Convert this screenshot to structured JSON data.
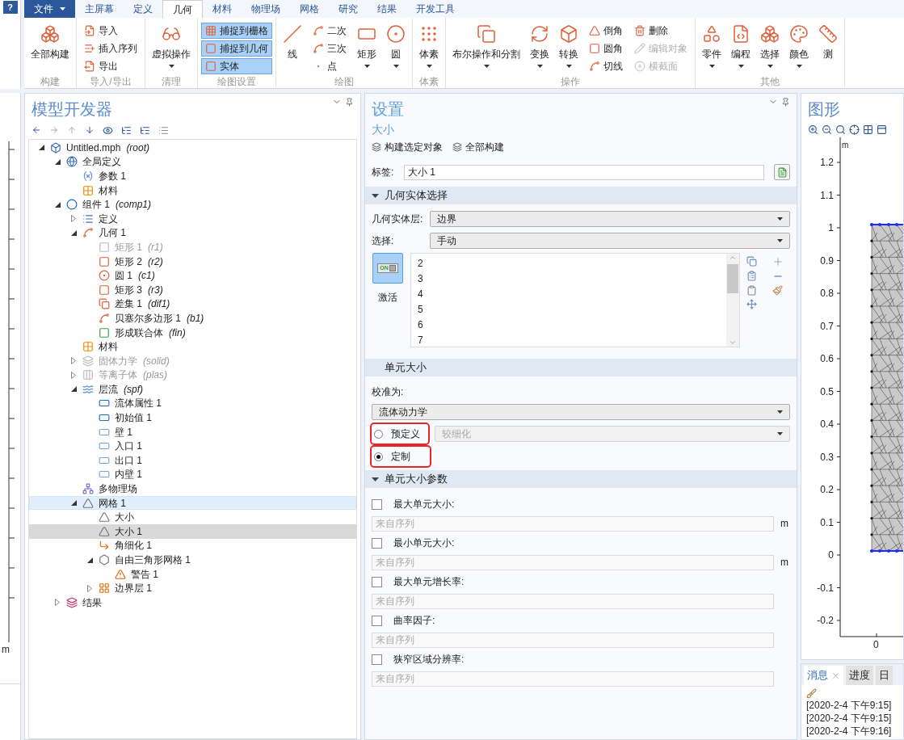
{
  "left_strip": {
    "help": "?",
    "axis_unit": "m"
  },
  "file_menu": {
    "label": "文件"
  },
  "tabs": [
    {
      "label": "主屏幕",
      "selected": false
    },
    {
      "label": "定义",
      "selected": false
    },
    {
      "label": "几何",
      "selected": true
    },
    {
      "label": "材料",
      "selected": false
    },
    {
      "label": "物理场",
      "selected": false
    },
    {
      "label": "网格",
      "selected": false
    },
    {
      "label": "研究",
      "selected": false
    },
    {
      "label": "结果",
      "selected": false
    },
    {
      "label": "开发工具",
      "selected": false
    }
  ],
  "ribbon": [
    {
      "label": "构建",
      "items": [
        {
          "kind": "large",
          "label": "全部构建",
          "dropdown": false
        }
      ]
    },
    {
      "label": "导入/导出",
      "items": [
        {
          "kind": "stack",
          "items": [
            {
              "label": "导入",
              "disabled": false
            },
            {
              "label": "插入序列",
              "disabled": false
            },
            {
              "label": "导出",
              "disabled": false
            }
          ]
        }
      ]
    },
    {
      "label": "清理",
      "items": [
        {
          "kind": "large",
          "label": "虚拟操作",
          "dropdown": true
        }
      ]
    },
    {
      "label": "绘图设置",
      "items": [
        {
          "kind": "toggles",
          "items": [
            {
              "label": "捕捉到栅格",
              "on": true
            },
            {
              "label": "捕捉到几何",
              "on": true
            },
            {
              "label": "实体",
              "on": true
            }
          ]
        }
      ]
    },
    {
      "label": "绘图",
      "items": [
        {
          "kind": "large",
          "label": "线",
          "dropdown": false
        },
        {
          "kind": "stack",
          "items": [
            {
              "label": "二次",
              "disabled": false
            },
            {
              "label": "三次",
              "disabled": false
            },
            {
              "label": "点",
              "disabled": false
            }
          ]
        },
        {
          "kind": "large",
          "label": "矩形",
          "dropdown": true
        },
        {
          "kind": "large",
          "label": "圆",
          "dropdown": true
        }
      ]
    },
    {
      "label": "体素",
      "items": [
        {
          "kind": "large",
          "label": "体素",
          "dropdown": true
        }
      ]
    },
    {
      "label": "操作",
      "items": [
        {
          "kind": "large",
          "label": "布尔操作和分割",
          "dropdown": true
        },
        {
          "kind": "large",
          "label": "变换",
          "dropdown": true
        },
        {
          "kind": "large",
          "label": "转换",
          "dropdown": true
        },
        {
          "kind": "stack",
          "items": [
            {
              "label": "倒角",
              "disabled": false
            },
            {
              "label": "圆角",
              "disabled": false
            },
            {
              "label": "切线",
              "disabled": false
            }
          ]
        },
        {
          "kind": "stack",
          "items": [
            {
              "label": "删除",
              "disabled": false
            },
            {
              "label": "编辑对象",
              "disabled": true
            },
            {
              "label": "横截面",
              "disabled": true
            }
          ]
        }
      ]
    },
    {
      "label": "其他",
      "items": [
        {
          "kind": "large",
          "label": "零件",
          "dropdown": true
        },
        {
          "kind": "large",
          "label": "编程",
          "dropdown": true
        },
        {
          "kind": "large",
          "label": "选择",
          "dropdown": true
        },
        {
          "kind": "large",
          "label": "颜色",
          "dropdown": true
        },
        {
          "kind": "large",
          "label": "测",
          "dropdown": false
        }
      ]
    }
  ],
  "model_builder": {
    "title": "模型开发器",
    "tree": [
      {
        "kind": "root",
        "label": "Untitled.mph",
        "tag": "(root)",
        "expanded": true,
        "selected": false,
        "highlighted": false,
        "disabled": false,
        "children": [
          {
            "kind": "globals",
            "label": "全局定义",
            "expanded": true,
            "selected": false,
            "highlighted": false,
            "disabled": false,
            "children": [
              {
                "kind": "parameters",
                "label": "参数 1",
                "selected": false,
                "highlighted": false,
                "disabled": false
              },
              {
                "kind": "materials",
                "label": "材料",
                "selected": false,
                "highlighted": false,
                "disabled": false
              }
            ]
          },
          {
            "kind": "component",
            "label": "组件 1",
            "tag": "(comp1)",
            "expanded": true,
            "selected": false,
            "highlighted": false,
            "disabled": false,
            "children": [
              {
                "kind": "definitions",
                "label": "定义",
                "expanded": false,
                "selected": false,
                "highlighted": false,
                "disabled": false
              },
              {
                "kind": "geometry",
                "label": "几何 1",
                "expanded": true,
                "selected": false,
                "highlighted": false,
                "disabled": false,
                "children": [
                  {
                    "kind": "rectangle",
                    "label": "矩形 1",
                    "tag": "(r1)",
                    "selected": false,
                    "highlighted": false,
                    "disabled": true
                  },
                  {
                    "kind": "rectangle",
                    "label": "矩形 2",
                    "tag": "(r2)",
                    "selected": false,
                    "highlighted": false,
                    "disabled": false
                  },
                  {
                    "kind": "circle",
                    "label": "圆 1",
                    "tag": "(c1)",
                    "selected": false,
                    "highlighted": false,
                    "disabled": false
                  },
                  {
                    "kind": "rectangle",
                    "label": "矩形 3",
                    "tag": "(r3)",
                    "selected": false,
                    "highlighted": false,
                    "disabled": false
                  },
                  {
                    "kind": "difference",
                    "label": "差集 1",
                    "tag": "(dif1)",
                    "selected": false,
                    "highlighted": false,
                    "disabled": false
                  },
                  {
                    "kind": "bezier",
                    "label": "贝塞尔多边形 1",
                    "tag": "(b1)",
                    "selected": false,
                    "highlighted": false,
                    "disabled": false
                  },
                  {
                    "kind": "union",
                    "label": "形成联合体",
                    "tag": "(fin)",
                    "selected": false,
                    "highlighted": false,
                    "disabled": false
                  }
                ]
              },
              {
                "kind": "materials",
                "label": "材料",
                "selected": false,
                "highlighted": false,
                "disabled": false
              },
              {
                "kind": "solid",
                "label": "固体力学",
                "tag": "(solid)",
                "expanded": false,
                "selected": false,
                "highlighted": false,
                "disabled": true
              },
              {
                "kind": "plasma",
                "label": "等离子体",
                "tag": "(plas)",
                "expanded": false,
                "selected": false,
                "highlighted": false,
                "disabled": true
              },
              {
                "kind": "flow",
                "label": "层流",
                "tag": "(spf)",
                "expanded": true,
                "selected": false,
                "highlighted": false,
                "disabled": false,
                "children": [
                  {
                    "kind": "domain_feature",
                    "label": "流体属性 1",
                    "selected": false,
                    "highlighted": false,
                    "disabled": false
                  },
                  {
                    "kind": "domain_feature",
                    "label": "初始值 1",
                    "selected": false,
                    "highlighted": false,
                    "disabled": false
                  },
                  {
                    "kind": "boundary_feature",
                    "label": "壁 1",
                    "selected": false,
                    "highlighted": false,
                    "disabled": false
                  },
                  {
                    "kind": "boundary_feature",
                    "label": "入口 1",
                    "selected": false,
                    "highlighted": false,
                    "disabled": false
                  },
                  {
                    "kind": "boundary_feature",
                    "label": "出口 1",
                    "selected": false,
                    "highlighted": false,
                    "disabled": false
                  },
                  {
                    "kind": "boundary_feature",
                    "label": "内壁 1",
                    "selected": false,
                    "highlighted": false,
                    "disabled": false
                  }
                ]
              },
              {
                "kind": "multiphysics",
                "label": "多物理场",
                "selected": false,
                "highlighted": false,
                "disabled": false
              },
              {
                "kind": "mesh",
                "label": "网格 1",
                "expanded": true,
                "selected": false,
                "highlighted": true,
                "disabled": false,
                "children": [
                  {
                    "kind": "size",
                    "label": "大小",
                    "selected": false,
                    "highlighted": false,
                    "disabled": false
                  },
                  {
                    "kind": "size",
                    "label": "大小 1",
                    "selected": true,
                    "highlighted": false,
                    "disabled": false
                  },
                  {
                    "kind": "refine",
                    "label": "角细化 1",
                    "selected": false,
                    "highlighted": false,
                    "disabled": false
                  },
                  {
                    "kind": "free_tri",
                    "label": "自由三角形网格 1",
                    "expanded": true,
                    "selected": false,
                    "highlighted": false,
                    "disabled": false,
                    "children": [
                      {
                        "kind": "warning",
                        "label": "警告 1",
                        "selected": false,
                        "highlighted": false,
                        "disabled": false
                      }
                    ]
                  },
                  {
                    "kind": "boundary_layer",
                    "label": "边界层 1",
                    "expanded": false,
                    "selected": false,
                    "highlighted": false,
                    "disabled": false
                  }
                ]
              }
            ]
          },
          {
            "kind": "results",
            "label": "结果",
            "expanded": false,
            "selected": false,
            "highlighted": false,
            "disabled": false
          }
        ]
      }
    ]
  },
  "settings": {
    "title": "设置",
    "subtitle": "大小",
    "toolbar": [
      "构建选定对象",
      "全部构建"
    ],
    "label_field": {
      "label": "标签:",
      "value": "大小 1"
    },
    "selection_section": {
      "title": "几何实体选择",
      "expanded": true,
      "level": {
        "label": "几何实体层:",
        "value": "边界"
      },
      "selection": {
        "label": "选择:",
        "value": "手动"
      },
      "active": {
        "label": "激活",
        "switch_text": "ON",
        "on": true
      },
      "entities": [
        "2",
        "3",
        "4",
        "5",
        "6",
        "7"
      ]
    },
    "size_section": {
      "title": "单元大小",
      "calibrate": {
        "label": "校准为:",
        "value": "流体动力学"
      },
      "options": [
        {
          "label": "预定义",
          "selected": false,
          "highlighted": true,
          "preset": {
            "value": "较细化",
            "disabled": true
          }
        },
        {
          "label": "定制",
          "selected": true,
          "highlighted": true
        }
      ]
    },
    "params_section": {
      "title": "单元大小参数",
      "expanded": true,
      "params": [
        {
          "label": "最大单元大小:",
          "checked": false,
          "placeholder": "来自序列",
          "unit": "m"
        },
        {
          "label": "最小单元大小:",
          "checked": false,
          "placeholder": "来自序列",
          "unit": "m"
        },
        {
          "label": "最大单元增长率:",
          "checked": false,
          "placeholder": "来自序列"
        },
        {
          "label": "曲率因子:",
          "checked": false,
          "placeholder": "来自序列"
        },
        {
          "label": "狭窄区域分辨率:",
          "checked": false,
          "placeholder": "来自序列"
        }
      ]
    }
  },
  "graphics": {
    "title": "图形",
    "unit": "m",
    "y_ticks": [
      "1.2",
      "1.1",
      "1",
      "0.9",
      "0.8",
      "0.7",
      "0.6",
      "0.5",
      "0.4",
      "0.3",
      "0.2",
      "0.1",
      "0",
      "-0.1",
      "-0.2"
    ],
    "x_ticks": [
      "0"
    ]
  },
  "messages": {
    "tabs": [
      {
        "label": "消息",
        "selected": true,
        "closable": true
      },
      {
        "label": "进度",
        "selected": false,
        "closable": false
      },
      {
        "label": "日",
        "selected": false,
        "closable": false
      }
    ],
    "lines": [
      "[2020-2-4 下午9:15]",
      "[2020-2-4 下午9:15]",
      "[2020-2-4 下午9:16]"
    ]
  }
}
